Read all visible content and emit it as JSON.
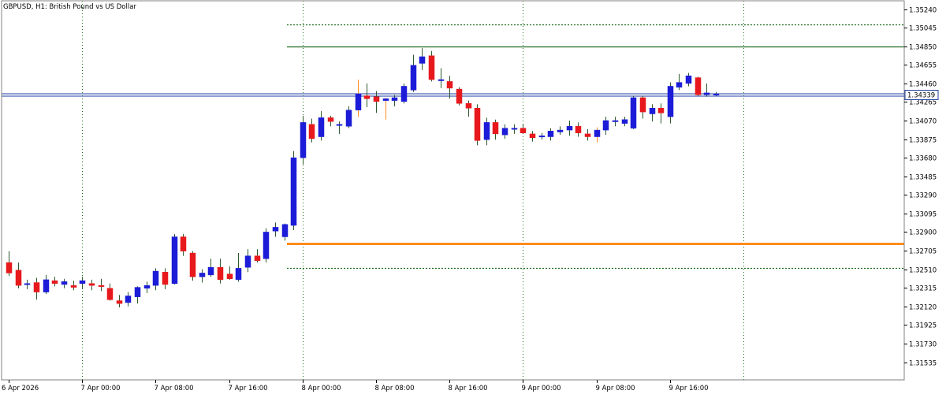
{
  "window": {
    "title": "GBPUSD, H1:  British Pound vs US Dollar"
  },
  "colors": {
    "background": "#ffffff",
    "frame": "#808080",
    "bull_body": "#1c1cd8",
    "bear_body": "#e8191c",
    "wick": "#2d5a2d",
    "grid": "#1a6b1a",
    "resistance_line": "#1a6b1a",
    "support_line": "#ff8c1a",
    "current_price_line": "#1f3fa0"
  },
  "chart_data": {
    "type": "candlestick",
    "symbol": "GBPUSD",
    "timeframe": "H1",
    "y_ticks": [
      "1.35240",
      "1.35045",
      "1.34850",
      "1.34655",
      "1.34460",
      "1.34265",
      "1.34070",
      "1.33875",
      "1.33680",
      "1.33485",
      "1.33290",
      "1.33095",
      "1.32900",
      "1.32705",
      "1.32510",
      "1.32315",
      "1.32120",
      "1.31925",
      "1.31730",
      "1.31535"
    ],
    "ylim": [
      1.3142,
      1.3534
    ],
    "x_ticks": [
      "6 Apr 2026",
      "7 Apr 00:00",
      "7 Apr 08:00",
      "7 Apr 16:00",
      "8 Apr 00:00",
      "8 Apr 08:00",
      "8 Apr 16:00",
      "9 Apr 00:00",
      "9 Apr 08:00",
      "9 Apr 16:00"
    ],
    "current_price": "1.34339",
    "levels": [
      {
        "price": 1.3508,
        "style": "dotted",
        "color": "#1a6b1a",
        "from_index": 31
      },
      {
        "price": 1.3485,
        "style": "solid",
        "color": "#1a6b1a",
        "from_index": 31
      },
      {
        "price": 1.3278,
        "style": "solid",
        "color": "#ff8c1a",
        "from_index": 31
      },
      {
        "price": 1.32525,
        "style": "dotted",
        "color": "#1a6b1a",
        "from_index": 31
      }
    ],
    "candles": [
      [
        1.3258,
        1.327,
        1.3244,
        1.3247
      ],
      [
        1.325,
        1.3258,
        1.3231,
        1.3234
      ],
      [
        1.3235,
        1.324,
        1.323,
        1.3236
      ],
      [
        1.3237,
        1.3242,
        1.3219,
        1.3227
      ],
      [
        1.3227,
        1.3245,
        1.3225,
        1.324
      ],
      [
        1.3239,
        1.3243,
        1.3233,
        1.3236
      ],
      [
        1.3235,
        1.3241,
        1.3231,
        1.3238
      ],
      [
        1.3234,
        1.3239,
        1.3229,
        1.3232
      ],
      [
        1.3236,
        1.3243,
        1.323,
        1.3239
      ],
      [
        1.3236,
        1.324,
        1.3229,
        1.3234
      ],
      [
        1.3234,
        1.3241,
        1.3228,
        1.3233
      ],
      [
        1.3231,
        1.3236,
        1.3218,
        1.3219
      ],
      [
        1.3218,
        1.3224,
        1.3211,
        1.3215
      ],
      [
        1.3216,
        1.3227,
        1.3212,
        1.3223
      ],
      [
        1.3222,
        1.3233,
        1.3215,
        1.3232
      ],
      [
        1.3231,
        1.3238,
        1.3226,
        1.3234
      ],
      [
        1.3234,
        1.3252,
        1.3229,
        1.3249
      ],
      [
        1.3248,
        1.3252,
        1.323,
        1.3235
      ],
      [
        1.3236,
        1.3288,
        1.3235,
        1.3285
      ],
      [
        1.3285,
        1.3288,
        1.3265,
        1.327
      ],
      [
        1.3268,
        1.327,
        1.3239,
        1.3243
      ],
      [
        1.3243,
        1.3251,
        1.3237,
        1.3247
      ],
      [
        1.3245,
        1.3262,
        1.3243,
        1.3253
      ],
      [
        1.3253,
        1.3262,
        1.3236,
        1.324
      ],
      [
        1.3246,
        1.3254,
        1.324,
        1.3241
      ],
      [
        1.324,
        1.3268,
        1.3238,
        1.3252
      ],
      [
        1.3253,
        1.3272,
        1.3248,
        1.3265
      ],
      [
        1.3265,
        1.3272,
        1.3258,
        1.326
      ],
      [
        1.3262,
        1.3294,
        1.3258,
        1.329
      ],
      [
        1.3291,
        1.33,
        1.3285,
        1.3295
      ],
      [
        1.3285,
        1.3299,
        1.3281,
        1.3298
      ],
      [
        1.3297,
        1.3375,
        1.3292,
        1.3368
      ],
      [
        1.3368,
        1.3412,
        1.3361,
        1.3405
      ],
      [
        1.3403,
        1.3409,
        1.3384,
        1.3388
      ],
      [
        1.339,
        1.3417,
        1.3386,
        1.341
      ],
      [
        1.341,
        1.3412,
        1.3401,
        1.3406
      ],
      [
        1.3402,
        1.3406,
        1.3393,
        1.3403
      ],
      [
        1.3401,
        1.3422,
        1.3399,
        1.3418
      ],
      [
        1.3418,
        1.345,
        1.3411,
        1.3435
      ],
      [
        1.3433,
        1.3446,
        1.3421,
        1.343
      ],
      [
        1.3432,
        1.3438,
        1.3415,
        1.3427
      ],
      [
        1.3428,
        1.3431,
        1.3408,
        1.343
      ],
      [
        1.3428,
        1.3434,
        1.3422,
        1.3431
      ],
      [
        1.3427,
        1.3446,
        1.3425,
        1.3443
      ],
      [
        1.3439,
        1.3476,
        1.3437,
        1.3465
      ],
      [
        1.3467,
        1.3483,
        1.346,
        1.3474
      ],
      [
        1.3475,
        1.348,
        1.3448,
        1.345
      ],
      [
        1.345,
        1.3462,
        1.3441,
        1.345
      ],
      [
        1.3448,
        1.3454,
        1.343,
        1.3441
      ],
      [
        1.344,
        1.3442,
        1.3423,
        1.3425
      ],
      [
        1.3425,
        1.3428,
        1.3411,
        1.342
      ],
      [
        1.342,
        1.3424,
        1.3381,
        1.3386
      ],
      [
        1.3387,
        1.341,
        1.3381,
        1.3405
      ],
      [
        1.3405,
        1.3408,
        1.3387,
        1.3393
      ],
      [
        1.3392,
        1.3403,
        1.3388,
        1.3399
      ],
      [
        1.3398,
        1.3403,
        1.3393,
        1.3399
      ],
      [
        1.3399,
        1.3403,
        1.3393,
        1.3394
      ],
      [
        1.3393,
        1.3396,
        1.3385,
        1.3389
      ],
      [
        1.339,
        1.3394,
        1.3387,
        1.3391
      ],
      [
        1.339,
        1.3399,
        1.3386,
        1.3396
      ],
      [
        1.3395,
        1.3401,
        1.3392,
        1.3397
      ],
      [
        1.3397,
        1.3407,
        1.3391,
        1.3401
      ],
      [
        1.3401,
        1.3405,
        1.339,
        1.3394
      ],
      [
        1.3393,
        1.3398,
        1.3386,
        1.339
      ],
      [
        1.339,
        1.34,
        1.3384,
        1.3397
      ],
      [
        1.3397,
        1.3411,
        1.3392,
        1.3407
      ],
      [
        1.3406,
        1.3411,
        1.3401,
        1.3407
      ],
      [
        1.3404,
        1.3411,
        1.3401,
        1.3408
      ],
      [
        1.3399,
        1.3433,
        1.3398,
        1.3431
      ],
      [
        1.3431,
        1.3433,
        1.3409,
        1.3416
      ],
      [
        1.3414,
        1.3424,
        1.3406,
        1.342
      ],
      [
        1.342,
        1.3425,
        1.3404,
        1.3415
      ],
      [
        1.3411,
        1.3447,
        1.3404,
        1.3443
      ],
      [
        1.3442,
        1.3456,
        1.3439,
        1.3447
      ],
      [
        1.3446,
        1.3457,
        1.3443,
        1.3454
      ],
      [
        1.3452,
        1.3453,
        1.3433,
        1.3434
      ],
      [
        1.3434,
        1.3446,
        1.3432,
        1.3436
      ],
      [
        1.3435,
        1.3437,
        1.3433,
        1.3435
      ]
    ]
  }
}
